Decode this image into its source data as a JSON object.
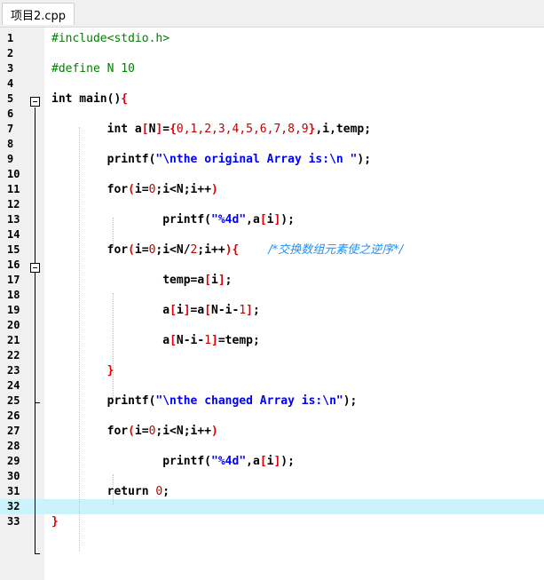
{
  "tab": {
    "title": "项目2.cpp"
  },
  "lines": [
    {
      "n": "1",
      "tokens": [
        {
          "t": "#include<stdio.h>",
          "c": "pp"
        }
      ]
    },
    {
      "n": "2",
      "tokens": []
    },
    {
      "n": "3",
      "tokens": [
        {
          "t": "#define N 10",
          "c": "pp"
        }
      ]
    },
    {
      "n": "4",
      "tokens": []
    },
    {
      "n": "5",
      "tokens": [
        {
          "t": "int main()",
          "c": "kw"
        },
        {
          "t": "{",
          "c": "br"
        }
      ]
    },
    {
      "n": "6",
      "tokens": []
    },
    {
      "n": "7",
      "tokens": [
        {
          "t": "        int a",
          "c": "kw"
        },
        {
          "t": "[",
          "c": "br"
        },
        {
          "t": "N",
          "c": "kw"
        },
        {
          "t": "]",
          "c": "br"
        },
        {
          "t": "=",
          "c": "kw"
        },
        {
          "t": "{",
          "c": "br"
        },
        {
          "t": "0,1,2,3,4,5,6,7,8,9",
          "c": "num"
        },
        {
          "t": "}",
          "c": "br"
        },
        {
          "t": ",i,temp;",
          "c": "kw"
        }
      ]
    },
    {
      "n": "8",
      "tokens": []
    },
    {
      "n": "9",
      "tokens": [
        {
          "t": "        printf(",
          "c": "kw"
        },
        {
          "t": "\"\\nthe original Array is:\\n \"",
          "c": "str"
        },
        {
          "t": ");",
          "c": "kw"
        }
      ]
    },
    {
      "n": "10",
      "tokens": []
    },
    {
      "n": "11",
      "tokens": [
        {
          "t": "        for",
          "c": "kw"
        },
        {
          "t": "(",
          "c": "br"
        },
        {
          "t": "i=",
          "c": "kw"
        },
        {
          "t": "0",
          "c": "num"
        },
        {
          "t": ";i<N;i++",
          "c": "kw"
        },
        {
          "t": ")",
          "c": "br"
        }
      ]
    },
    {
      "n": "12",
      "tokens": []
    },
    {
      "n": "13",
      "tokens": [
        {
          "t": "                printf(",
          "c": "kw"
        },
        {
          "t": "\"%4d\"",
          "c": "str"
        },
        {
          "t": ",a",
          "c": "kw"
        },
        {
          "t": "[",
          "c": "br"
        },
        {
          "t": "i",
          "c": "kw"
        },
        {
          "t": "]",
          "c": "br"
        },
        {
          "t": ");",
          "c": "kw"
        }
      ]
    },
    {
      "n": "14",
      "tokens": []
    },
    {
      "n": "15",
      "tokens": [
        {
          "t": "        for",
          "c": "kw"
        },
        {
          "t": "(",
          "c": "br"
        },
        {
          "t": "i=",
          "c": "kw"
        },
        {
          "t": "0",
          "c": "num"
        },
        {
          "t": ";i<N/",
          "c": "kw"
        },
        {
          "t": "2",
          "c": "num"
        },
        {
          "t": ";i++",
          "c": "kw"
        },
        {
          "t": "){",
          "c": "br"
        },
        {
          "t": "        /*交换数组元素使之逆序*/",
          "c": "cm"
        }
      ]
    },
    {
      "n": "16",
      "tokens": []
    },
    {
      "n": "17",
      "tokens": [
        {
          "t": "                temp=a",
          "c": "kw"
        },
        {
          "t": "[",
          "c": "br"
        },
        {
          "t": "i",
          "c": "kw"
        },
        {
          "t": "]",
          "c": "br"
        },
        {
          "t": ";",
          "c": "kw"
        }
      ]
    },
    {
      "n": "18",
      "tokens": []
    },
    {
      "n": "19",
      "tokens": [
        {
          "t": "                a",
          "c": "kw"
        },
        {
          "t": "[",
          "c": "br"
        },
        {
          "t": "i",
          "c": "kw"
        },
        {
          "t": "]",
          "c": "br"
        },
        {
          "t": "=a",
          "c": "kw"
        },
        {
          "t": "[",
          "c": "br"
        },
        {
          "t": "N-i-",
          "c": "kw"
        },
        {
          "t": "1",
          "c": "num"
        },
        {
          "t": "]",
          "c": "br"
        },
        {
          "t": ";",
          "c": "kw"
        }
      ]
    },
    {
      "n": "20",
      "tokens": []
    },
    {
      "n": "21",
      "tokens": [
        {
          "t": "                a",
          "c": "kw"
        },
        {
          "t": "[",
          "c": "br"
        },
        {
          "t": "N-i-",
          "c": "kw"
        },
        {
          "t": "1",
          "c": "num"
        },
        {
          "t": "]",
          "c": "br"
        },
        {
          "t": "=temp;",
          "c": "kw"
        }
      ]
    },
    {
      "n": "22",
      "tokens": []
    },
    {
      "n": "23",
      "tokens": [
        {
          "t": "        }",
          "c": "br"
        }
      ]
    },
    {
      "n": "24",
      "tokens": []
    },
    {
      "n": "25",
      "tokens": [
        {
          "t": "        printf(",
          "c": "kw"
        },
        {
          "t": "\"\\nthe changed Array is:\\n\"",
          "c": "str"
        },
        {
          "t": ");",
          "c": "kw"
        }
      ]
    },
    {
      "n": "26",
      "tokens": []
    },
    {
      "n": "27",
      "tokens": [
        {
          "t": "        for",
          "c": "kw"
        },
        {
          "t": "(",
          "c": "br"
        },
        {
          "t": "i=",
          "c": "kw"
        },
        {
          "t": "0",
          "c": "num"
        },
        {
          "t": ";i<N;i++",
          "c": "kw"
        },
        {
          "t": ")",
          "c": "br"
        }
      ]
    },
    {
      "n": "28",
      "tokens": []
    },
    {
      "n": "29",
      "tokens": [
        {
          "t": "                printf(",
          "c": "kw"
        },
        {
          "t": "\"%4d\"",
          "c": "str"
        },
        {
          "t": ",a",
          "c": "kw"
        },
        {
          "t": "[",
          "c": "br"
        },
        {
          "t": "i",
          "c": "kw"
        },
        {
          "t": "]",
          "c": "br"
        },
        {
          "t": ");",
          "c": "kw"
        }
      ]
    },
    {
      "n": "30",
      "tokens": []
    },
    {
      "n": "31",
      "tokens": [
        {
          "t": "        return ",
          "c": "kw"
        },
        {
          "t": "0",
          "c": "num"
        },
        {
          "t": ";",
          "c": "kw"
        }
      ]
    },
    {
      "n": "32",
      "tokens": [],
      "highlight": true
    },
    {
      "n": "33",
      "tokens": [
        {
          "t": "}",
          "c": "br"
        }
      ]
    }
  ]
}
